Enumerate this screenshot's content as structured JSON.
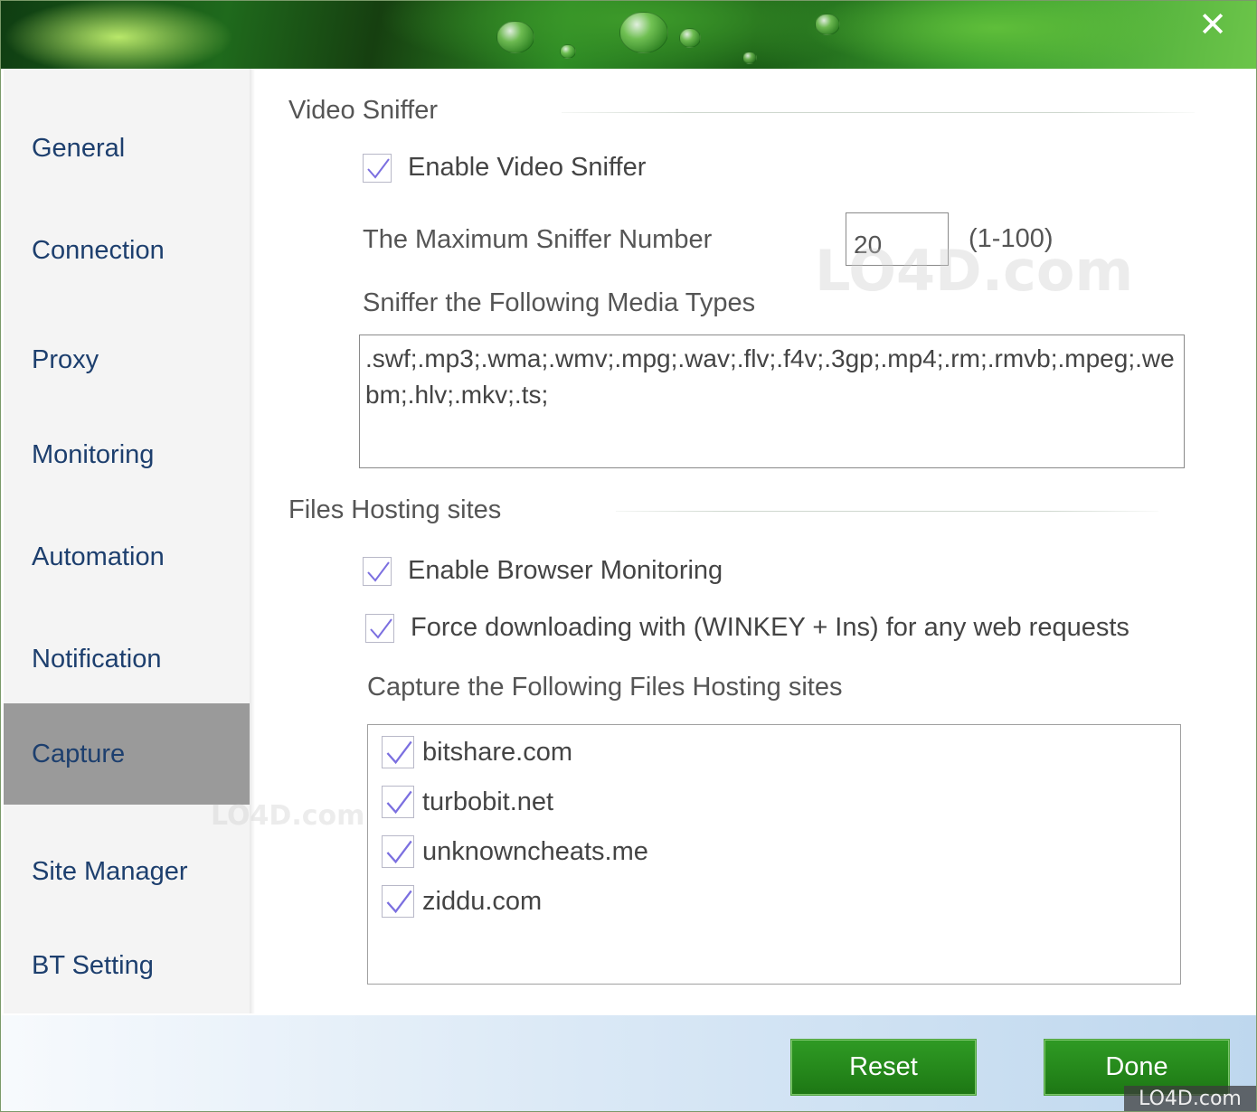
{
  "window": {
    "close_glyph": "✕"
  },
  "sidebar": {
    "items": [
      {
        "label": "General",
        "name": "general"
      },
      {
        "label": "Connection",
        "name": "connection"
      },
      {
        "label": "Proxy",
        "name": "proxy"
      },
      {
        "label": "Monitoring",
        "name": "monitoring"
      },
      {
        "label": "Automation",
        "name": "automation"
      },
      {
        "label": "Notification",
        "name": "notification"
      },
      {
        "label": "Capture",
        "name": "capture",
        "active": true
      },
      {
        "label": "Site Manager",
        "name": "site-manager"
      },
      {
        "label": "BT Setting",
        "name": "bt-setting"
      }
    ]
  },
  "video_sniffer": {
    "title": "Video Sniffer",
    "enable_label": "Enable Video Sniffer",
    "enable_checked": true,
    "max_label": "The Maximum Sniffer Number",
    "max_value": "20",
    "max_range": "(1-100)",
    "media_label": "Sniffer the Following Media Types",
    "media_value": ".swf;.mp3;.wma;.wmv;.mpg;.wav;.flv;.f4v;.3gp;.mp4;.rm;.rmvb;.mpeg;.webm;.hlv;.mkv;.ts;"
  },
  "files_hosting": {
    "title": "Files Hosting sites",
    "browser_monitoring_label": "Enable Browser Monitoring",
    "browser_monitoring_checked": true,
    "force_label": "Force downloading with (WINKEY + Ins) for any web requests",
    "force_checked": true,
    "capture_label": "Capture the Following Files Hosting sites",
    "sites": [
      {
        "label": "bitshare.com",
        "checked": true
      },
      {
        "label": "turbobit.net",
        "checked": true
      },
      {
        "label": "unknowncheats.me",
        "checked": true
      },
      {
        "label": "ziddu.com",
        "checked": true
      }
    ]
  },
  "footer": {
    "reset_label": "Reset",
    "done_label": "Done"
  },
  "watermark": {
    "text": "LO4D.com"
  },
  "colors": {
    "accent_green": "#268a1c",
    "nav_text": "#1d3f6e",
    "active_nav_bg": "#9a9a9a",
    "check_color": "#7b6fe0"
  }
}
